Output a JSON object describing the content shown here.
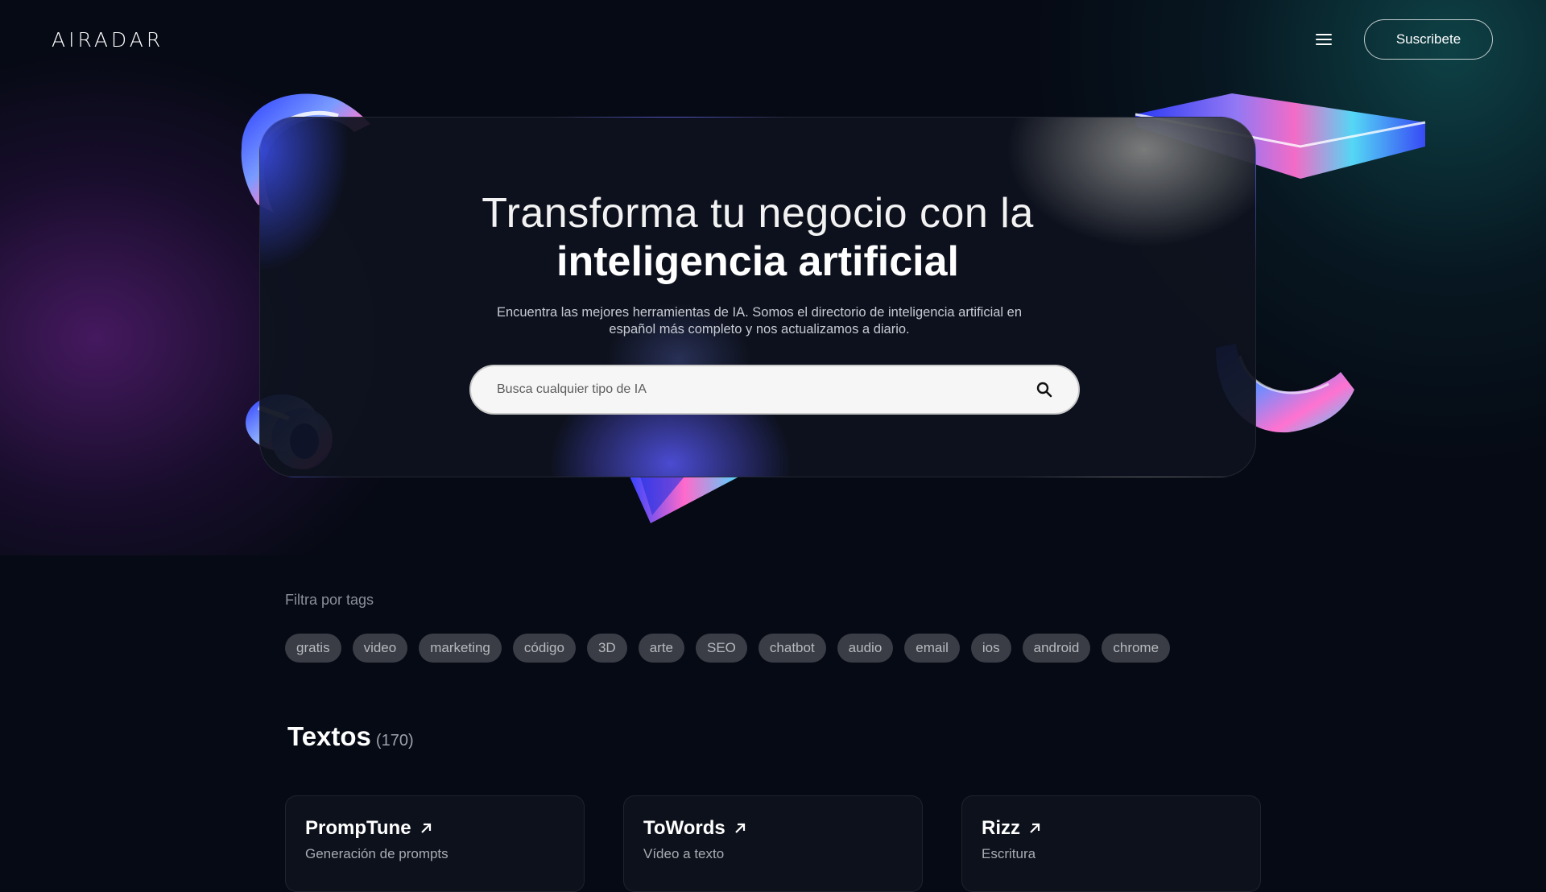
{
  "header": {
    "logo": "AIRADAR",
    "menu_icon": "hamburger-menu-icon",
    "subscribe_label": "Suscribete"
  },
  "hero": {
    "title_line1": "Transforma tu negocio con la",
    "title_line2": "inteligencia artificial",
    "subtitle": "Encuentra las mejores herramientas de IA. Somos el directorio de inteligencia artificial en español más completo y nos actualizamos a diario.",
    "search": {
      "placeholder": "Busca cualquier tipo de IA",
      "icon": "search-icon"
    }
  },
  "tags": {
    "label": "Filtra por tags",
    "items": [
      "gratis",
      "video",
      "marketing",
      "código",
      "3D",
      "arte",
      "SEO",
      "chatbot",
      "audio",
      "email",
      "ios",
      "android",
      "chrome"
    ]
  },
  "section": {
    "title": "Textos",
    "count": "(170)"
  },
  "tools": [
    {
      "name": "PrompTune",
      "category": "Generación de prompts"
    },
    {
      "name": "ToWords",
      "category": "Vídeo a texto"
    },
    {
      "name": "Rizz",
      "category": "Escritura"
    }
  ],
  "colors": {
    "background": "#060a14",
    "card": "#0d111b",
    "tag_bg": "#3a3d45",
    "accent_blue": "#3b4cff"
  }
}
